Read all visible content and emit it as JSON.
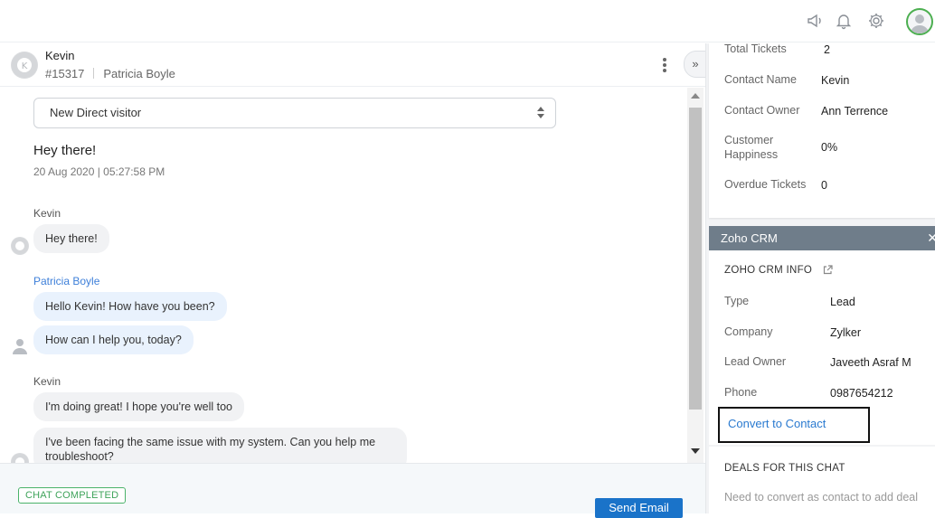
{
  "header": {
    "icons": [
      "announcement-icon",
      "bell-icon",
      "gear-icon",
      "user-avatar"
    ]
  },
  "chat": {
    "visitor_name": "Kevin",
    "ticket_id": "#15317",
    "agent_name": "Patricia Boyle",
    "visitor_type": "New Direct visitor",
    "greeting": "Hey there!",
    "timestamp": "20 Aug 2020 | 05:27:58 PM",
    "messages": [
      {
        "sender": "Kevin",
        "role": "visitor",
        "texts": [
          "Hey there!"
        ]
      },
      {
        "sender": "Patricia Boyle",
        "role": "agent",
        "texts": [
          "Hello Kevin! How have you been?",
          "How can I help you, today?"
        ]
      },
      {
        "sender": "Kevin",
        "role": "visitor",
        "texts": [
          "I'm doing great! I hope you're well too",
          "I've been facing the same issue with my system. Can you help me troubleshoot?"
        ]
      }
    ],
    "status": "CHAT COMPLETED",
    "send_email_label": "Send Email"
  },
  "contact": {
    "fields": [
      {
        "label": "Total Tickets",
        "value": "2"
      },
      {
        "label": "Contact Name",
        "value": "Kevin"
      },
      {
        "label": "Contact Owner",
        "value": "Ann Terrence"
      },
      {
        "label": "Customer Happiness",
        "value": "0%"
      },
      {
        "label": "Overdue Tickets",
        "value": "0"
      }
    ]
  },
  "crm": {
    "header": "Zoho CRM",
    "section_title": "ZOHO CRM INFO",
    "fields": [
      {
        "label": "Type",
        "value": "Lead"
      },
      {
        "label": "Company",
        "value": "Zylker"
      },
      {
        "label": "Lead Owner",
        "value": "Javeeth Asraf M"
      },
      {
        "label": "Phone",
        "value": "0987654212"
      }
    ],
    "convert_label": "Convert to Contact",
    "deals_title": "DEALS FOR THIS CHAT",
    "deals_hint": "Need to convert as contact to add deal"
  },
  "colors": {
    "accent": "#1a73c9",
    "agent_name": "#3d7fd9",
    "status_green": "#3ea35a",
    "crm_header_bg": "#6f7d8a"
  }
}
